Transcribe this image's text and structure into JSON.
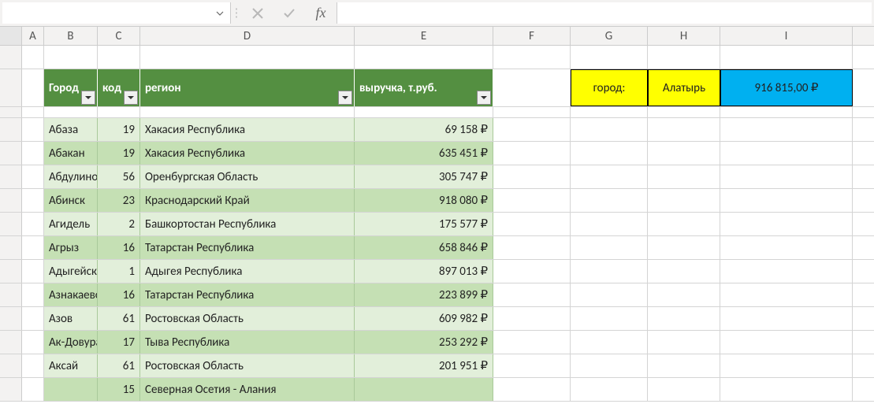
{
  "formula_bar": {
    "name_box_value": "",
    "cancel_title": "Cancel",
    "enter_title": "Enter",
    "fx_title": "Insert Function",
    "formula_value": ""
  },
  "columns": {
    "A": "A",
    "B": "B",
    "C": "C",
    "D": "D",
    "E": "E",
    "F": "F",
    "G": "G",
    "H": "H",
    "I": "I"
  },
  "table": {
    "headers": {
      "city": "Город",
      "code": "код",
      "region": "регион",
      "revenue": "выручка, т.руб."
    },
    "rows": [
      {
        "city": "Абаза",
        "code": "19",
        "region": "Хакасия Республика",
        "revenue": "69 158 ₽"
      },
      {
        "city": "Абакан",
        "code": "19",
        "region": "Хакасия Республика",
        "revenue": "635 451 ₽"
      },
      {
        "city": "Абдулино",
        "code": "56",
        "region": "Оренбургская Область",
        "revenue": "305 747 ₽"
      },
      {
        "city": "Абинск",
        "code": "23",
        "region": "Краснодарский Край",
        "revenue": "918 080 ₽"
      },
      {
        "city": "Агидель",
        "code": "2",
        "region": "Башкортостан Республика",
        "revenue": "175 577 ₽"
      },
      {
        "city": "Агрыз",
        "code": "16",
        "region": "Татарстан Республика",
        "revenue": "658 846 ₽"
      },
      {
        "city": "Адыгейск",
        "code": "1",
        "region": "Адыгея Республика",
        "revenue": "897 013 ₽"
      },
      {
        "city": "Азнакаево",
        "code": "16",
        "region": "Татарстан Республика",
        "revenue": "223 899 ₽"
      },
      {
        "city": "Азов",
        "code": "61",
        "region": "Ростовская Область",
        "revenue": "609 982 ₽"
      },
      {
        "city": "Ак-Довурак",
        "code": "17",
        "region": "Тыва Республика",
        "revenue": "253 292 ₽"
      },
      {
        "city": "Аксай",
        "code": "61",
        "region": "Ростовская Область",
        "revenue": "201 951 ₽"
      },
      {
        "city": "",
        "code": "15",
        "region": "Северная Осетия - Алания",
        "revenue": ""
      }
    ]
  },
  "lookup": {
    "label": "город:",
    "city": "Алатырь",
    "result": "916 815,00 ₽"
  }
}
